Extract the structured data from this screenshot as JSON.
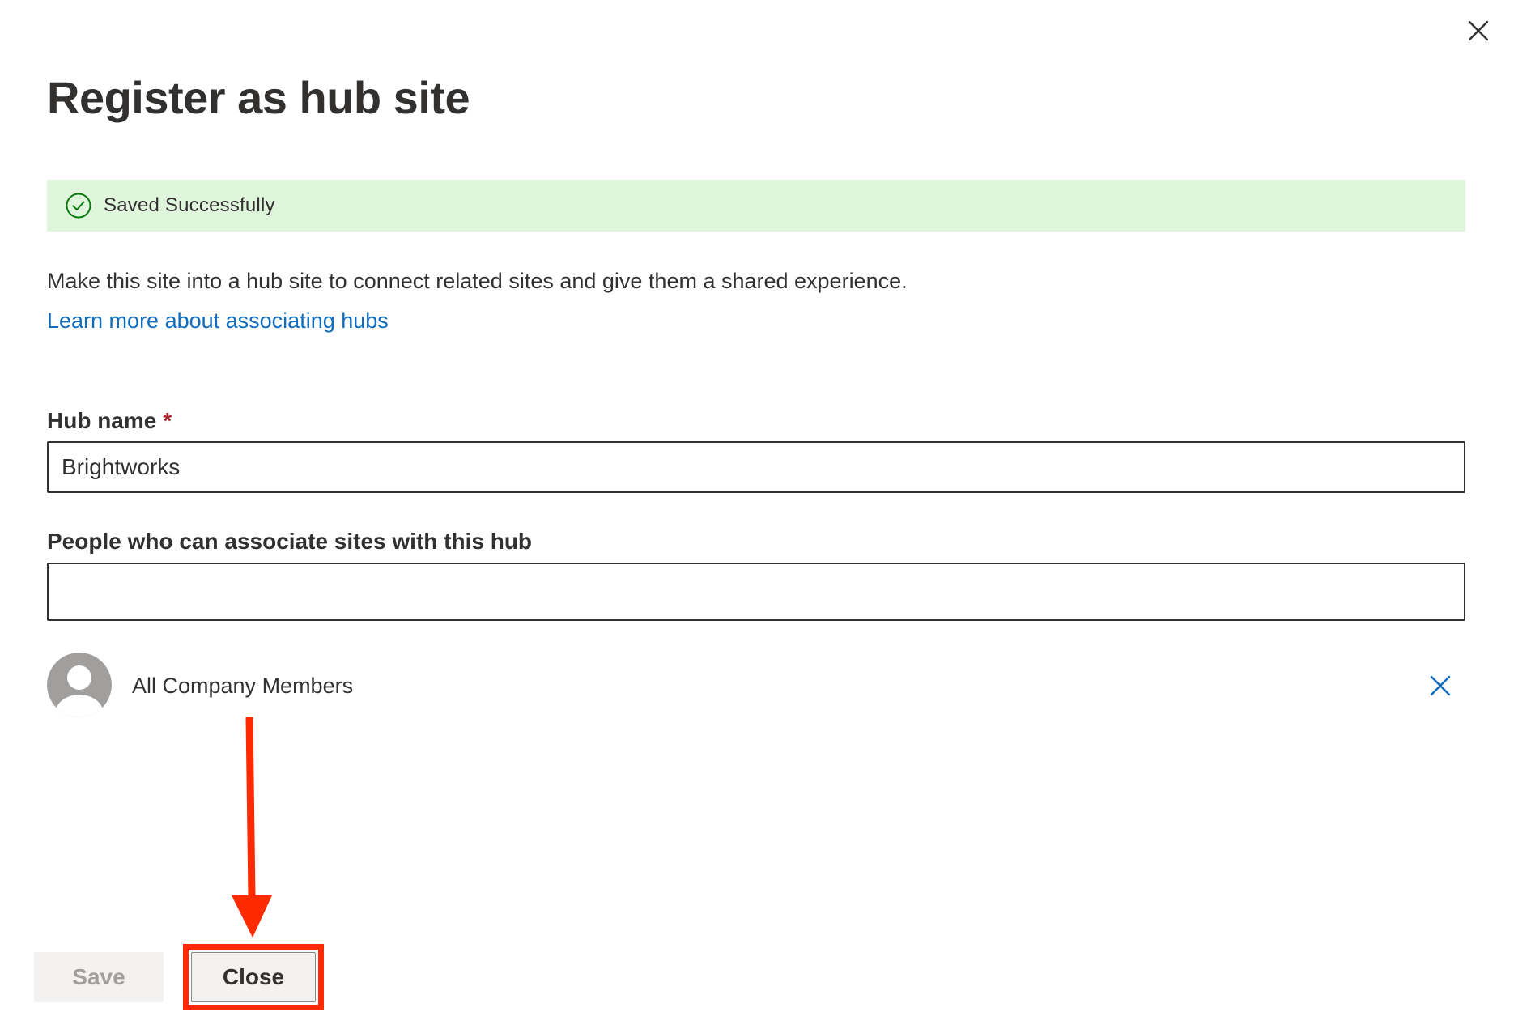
{
  "panel": {
    "title": "Register as hub site"
  },
  "status": {
    "message": "Saved Successfully"
  },
  "intro": {
    "description": "Make this site into a hub site to connect related sites and give them a shared experience.",
    "learn_more_link": "Learn more about associating hubs"
  },
  "hub_name": {
    "label": "Hub name",
    "required_marker": "*",
    "value": "Brightworks"
  },
  "people": {
    "label": "People who can associate sites with this hub",
    "value": "",
    "selected": [
      {
        "name": "All Company Members"
      }
    ]
  },
  "footer": {
    "save_label": "Save",
    "close_label": "Close"
  },
  "icons": {
    "dismiss": "close-icon",
    "success": "checkmark-circle-icon",
    "avatar": "person-icon",
    "remove": "remove-icon"
  },
  "colors": {
    "success_background": "#dff6dd",
    "success_icon": "#107c10",
    "link": "#0f6cbd",
    "required": "#a4262c",
    "annotation": "#ff2a00"
  }
}
